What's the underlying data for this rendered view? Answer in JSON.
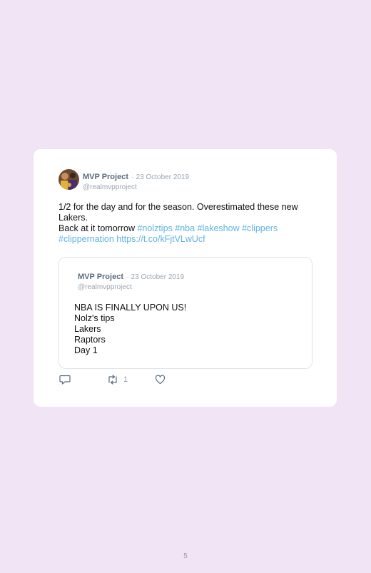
{
  "tweet": {
    "author_name": "MVP Project",
    "date": "· 23 October 2019",
    "handle": "@realmvpproject",
    "lines": [
      "1/2 for the day and for the season. Overestimated these new Lakers.",
      "Back at it tomorrow "
    ],
    "hashtags_line": "#nolztips #nba #lakeshow #clippers",
    "hashtags_line2": "#clippernation https://t.co/kFjtVLwUcf"
  },
  "quoted": {
    "author_name": "MVP Project",
    "date": "· 23 October 2019",
    "handle": "@realmvpproject",
    "lines": [
      "NBA IS FINALLY UPON US!",
      "Nolz's tips",
      "Lakers",
      "Raptors",
      "Day 1"
    ]
  },
  "actions": {
    "reply_icon": "comment-icon",
    "retweet_icon": "retweet-icon",
    "retweet_count": "1",
    "like_icon": "heart-icon"
  },
  "page_number": "5",
  "colors": {
    "background": "#f1e4f4",
    "card": "#ffffff",
    "link": "#5fb4e0"
  }
}
